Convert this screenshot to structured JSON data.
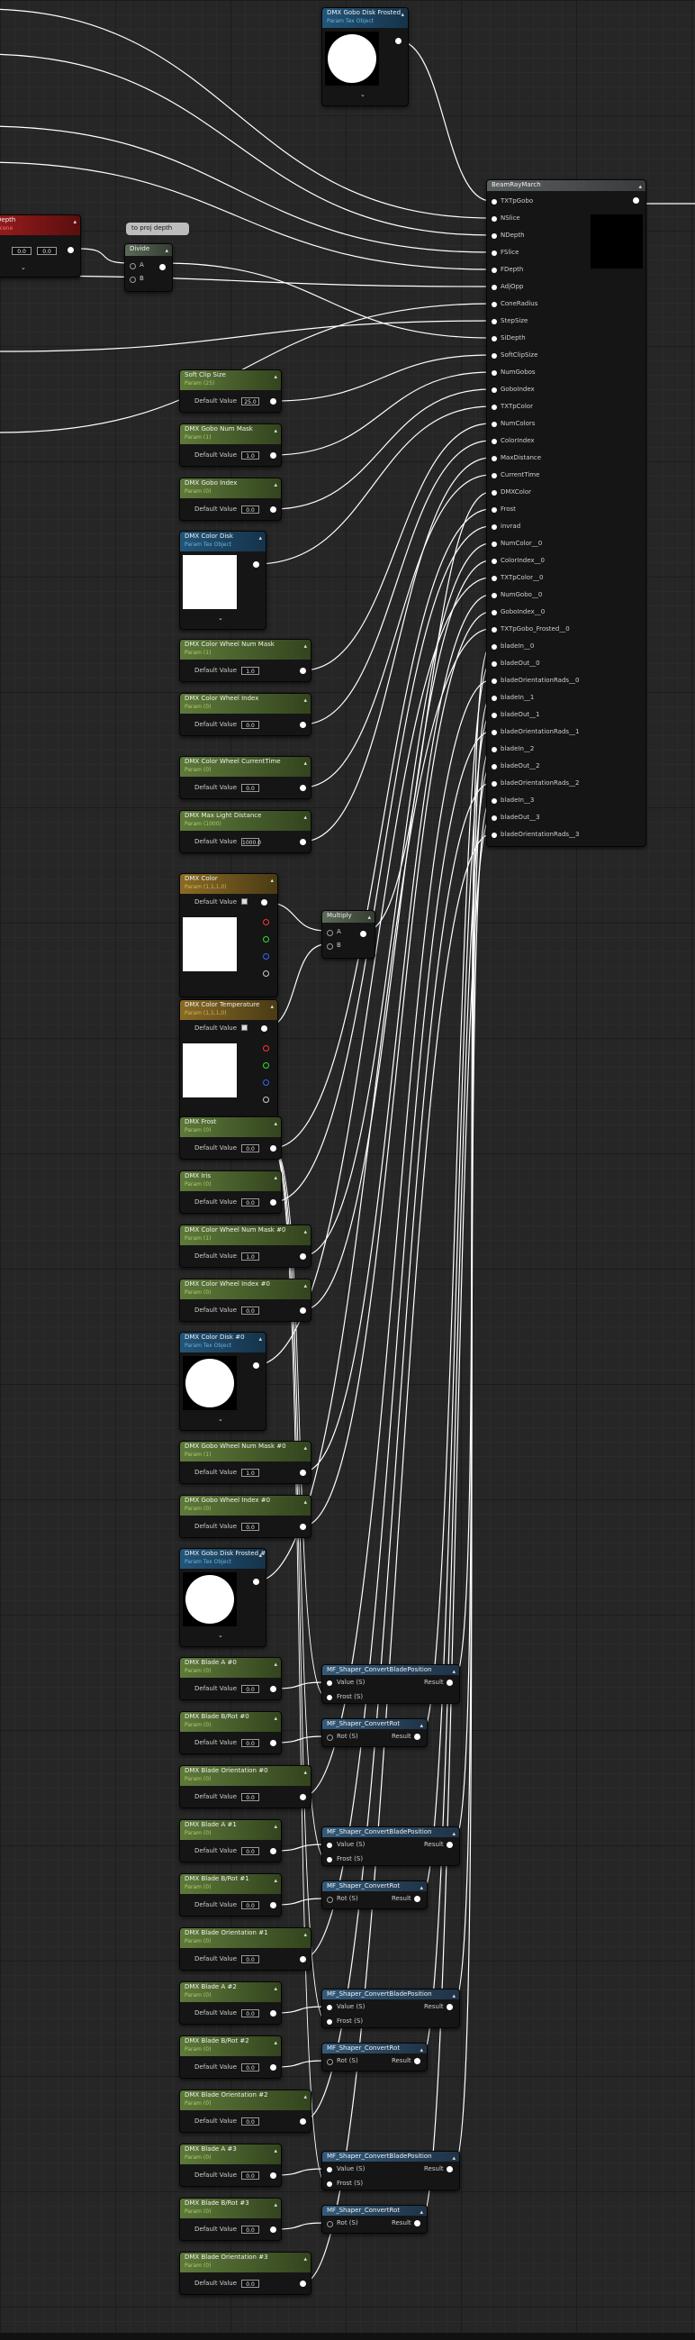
{
  "nodes": {
    "gobo_disk_frosted_top": {
      "title": "DMX Gobo Disk Frosted",
      "subtitle": "Param Tex Object"
    },
    "raymarch": {
      "title": "BeamRayMarch",
      "inputs": [
        "TXTpGobo",
        "NSlice",
        "NDepth",
        "FSlice",
        "FDepth",
        "AdjOpp",
        "ConeRadius",
        "StepSize",
        "SiDepth",
        "SoftClipSize",
        "NumGobos",
        "GoboIndex",
        "TXTpColor",
        "NumColors",
        "ColorIndex",
        "MaxDistance",
        "CurrentTime",
        "DMXColor",
        "Frost",
        "invrad",
        "NumColor__0",
        "ColorIndex__0",
        "TXTpColor__0",
        "NumGobo__0",
        "GoboIndex__0",
        "TXTpGobo_Frosted__0",
        "bladeIn__0",
        "bladeOut__0",
        "bladeOrientationRads__0",
        "bladeIn__1",
        "bladeOut__1",
        "bladeOrientationRads__1",
        "bladeIn__2",
        "bladeOut__2",
        "bladeOrientationRads__2",
        "bladeIn__3",
        "bladeOut__3",
        "bladeOrientationRads__3"
      ]
    },
    "depth": {
      "title": "Depth",
      "subtitle": "Scene",
      "v1": "0.0",
      "v2": "0.0"
    },
    "comment": {
      "text": "to proj depth"
    },
    "divide": {
      "title": "Divide",
      "a": "A",
      "b": "B"
    },
    "soft_clip": {
      "title": "Soft Clip Size",
      "subtitle": "Param (25)",
      "label": "Default Value",
      "value": "25.0"
    },
    "gobo_num_mask": {
      "title": "DMX Gobo Num Mask",
      "subtitle": "Param (1)",
      "label": "Default Value",
      "value": "1.0"
    },
    "gobo_index": {
      "title": "DMX Gobo Index",
      "subtitle": "Param (0)",
      "label": "Default Value",
      "value": "0.0"
    },
    "color_disk": {
      "title": "DMX Color Disk",
      "subtitle": "Param Tex Object"
    },
    "color_wheel_num_mask": {
      "title": "DMX Color Wheel Num Mask",
      "subtitle": "Param (1)",
      "label": "Default Value",
      "value": "1.0"
    },
    "color_wheel_index": {
      "title": "DMX Color Wheel Index",
      "subtitle": "Param (0)",
      "label": "Default Value",
      "value": "0.0"
    },
    "color_wheel_current_time": {
      "title": "DMX Color Wheel CurrentTime",
      "subtitle": "Param (0)",
      "label": "Default Value",
      "value": "0.0"
    },
    "max_light_distance": {
      "title": "DMX Max Light Distance",
      "subtitle": "Param (1000)",
      "label": "Default Value",
      "value": "1000.0"
    },
    "dmx_color": {
      "title": "DMX Color",
      "subtitle": "Param (1,1,1,0)",
      "label": "Default Value"
    },
    "multiply": {
      "title": "Multiply",
      "a": "A",
      "b": "B"
    },
    "color_temperature": {
      "title": "DMX Color Temperature",
      "subtitle": "Param (1,1,1,0)",
      "label": "Default Value"
    },
    "frost": {
      "title": "DMX Frost",
      "subtitle": "Param (0)",
      "label": "Default Value",
      "value": "0.0"
    },
    "iris": {
      "title": "DMX Iris",
      "subtitle": "Param (0)",
      "label": "Default Value",
      "value": "0.0"
    },
    "cw_num_mask_0": {
      "title": "DMX Color Wheel Num Mask #0",
      "subtitle": "Param (1)",
      "label": "Default Value",
      "value": "1.0"
    },
    "cw_index_0": {
      "title": "DMX Color Wheel Index #0",
      "subtitle": "Param (0)",
      "label": "Default Value",
      "value": "0.0"
    },
    "color_disk_0": {
      "title": "DMX Color Disk #0",
      "subtitle": "Param Tex Object"
    },
    "gw_num_mask_0": {
      "title": "DMX Gobo Wheel Num Mask #0",
      "subtitle": "Param (1)",
      "label": "Default Value",
      "value": "1.0"
    },
    "gw_index_0": {
      "title": "DMX Gobo Wheel Index #0",
      "subtitle": "Param (0)",
      "label": "Default Value",
      "value": "0.0"
    },
    "gobo_disk_frosted_0": {
      "title": "DMX Gobo Disk Frosted #0",
      "subtitle": "Param Tex Object"
    },
    "blade_a_0": {
      "title": "DMX Blade A #0",
      "subtitle": "Param (0)",
      "label": "Default Value",
      "value": "0.0"
    },
    "blade_b_0": {
      "title": "DMX Blade B/Rot #0",
      "subtitle": "Param (0)",
      "label": "Default Value",
      "value": "0.0"
    },
    "blade_orient_0": {
      "title": "DMX Blade Orientation #0",
      "subtitle": "Param (0)",
      "label": "Default Value",
      "value": "0.0"
    },
    "blade_a_1": {
      "title": "DMX Blade A #1",
      "subtitle": "Param (0)",
      "label": "Default Value",
      "value": "0.0"
    },
    "blade_b_1": {
      "title": "DMX Blade B/Rot #1",
      "subtitle": "Param (0)",
      "label": "Default Value",
      "value": "0.0"
    },
    "blade_orient_1": {
      "title": "DMX Blade Orientation #1",
      "subtitle": "Param (0)",
      "label": "Default Value",
      "value": "0.0"
    },
    "blade_a_2": {
      "title": "DMX Blade A #2",
      "subtitle": "Param (0)",
      "label": "Default Value",
      "value": "0.0"
    },
    "blade_b_2": {
      "title": "DMX Blade B/Rot #2",
      "subtitle": "Param (0)",
      "label": "Default Value",
      "value": "0.0"
    },
    "blade_orient_2": {
      "title": "DMX Blade Orientation #2",
      "subtitle": "Param (0)",
      "label": "Default Value",
      "value": "0.0"
    },
    "blade_a_3": {
      "title": "DMX Blade A #3",
      "subtitle": "Param (0)",
      "label": "Default Value",
      "value": "0.0"
    },
    "blade_b_3": {
      "title": "DMX Blade B/Rot #3",
      "subtitle": "Param (0)",
      "label": "Default Value",
      "value": "0.0"
    },
    "blade_orient_3": {
      "title": "DMX Blade Orientation #3",
      "subtitle": "Param (0)",
      "label": "Default Value",
      "value": "0.0"
    },
    "mf_blade_pos": {
      "title": "MF_Shaper_ConvertBladePosition",
      "in1": "Value (S)",
      "in2": "Frost (S)",
      "out": "Result"
    },
    "mf_rot": {
      "title": "MF_Shaper_ConvertRot",
      "in1": "Rot (S)",
      "out": "Result"
    }
  },
  "colors": {
    "accent_green": "#5e7a3a",
    "accent_blue": "#23557a",
    "accent_gold": "#8a6b25",
    "accent_red": "#9a1c1c",
    "wire": "#ffffff"
  }
}
